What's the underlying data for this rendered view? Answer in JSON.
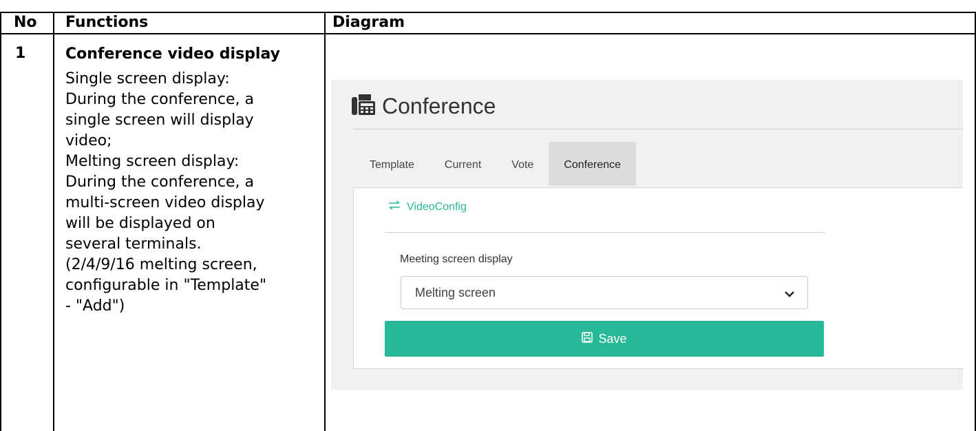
{
  "table": {
    "headers": {
      "no": "No",
      "functions": "Functions",
      "diagram": "Diagram"
    },
    "row": {
      "no": "1",
      "function_title": "Conference video display",
      "function_lines": [
        "Single screen display:",
        "During the conference, a",
        "single screen will display",
        "video;",
        "Melting screen display:",
        "During the conference, a",
        "multi-screen video display",
        "will be displayed on",
        "several terminals.",
        "(2/4/9/16 melting screen,",
        "configurable in \"Template\"",
        "- \"Add\")"
      ]
    }
  },
  "app": {
    "title": "Conference",
    "title_icon": "fax-icon",
    "tabs": [
      {
        "label": "Template",
        "active": false
      },
      {
        "label": "Current",
        "active": false
      },
      {
        "label": "Vote",
        "active": false
      },
      {
        "label": "Conference",
        "active": true
      }
    ],
    "section_link": {
      "label": "VideoConfig",
      "icon": "exchange-icon"
    },
    "field": {
      "label": "Meeting screen display",
      "value": "Melting screen"
    },
    "save_button": {
      "label": "Save",
      "icon": "floppy-disk-icon"
    },
    "colors": {
      "accent": "#26b897",
      "active_tab": "#dcdcdc",
      "panel_bg": "#f1f1f1"
    }
  }
}
